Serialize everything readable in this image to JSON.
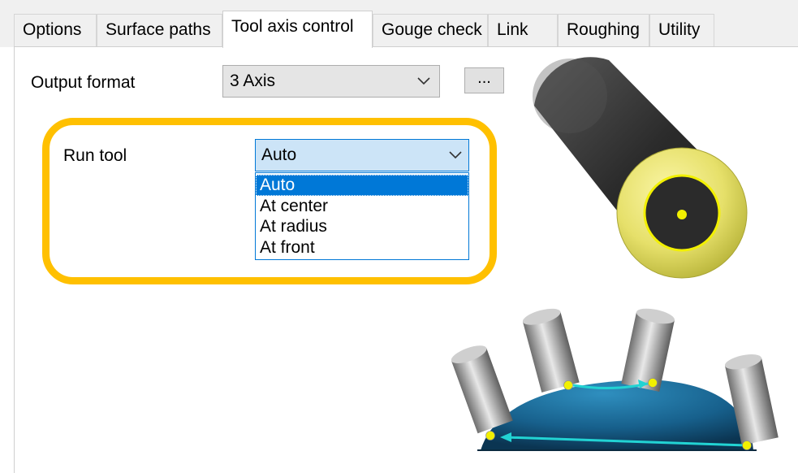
{
  "tabs": [
    {
      "label": "Options",
      "active": false
    },
    {
      "label": "Surface paths",
      "active": false
    },
    {
      "label": "Tool axis control",
      "active": true
    },
    {
      "label": "Gouge check",
      "active": false
    },
    {
      "label": "Link",
      "active": false
    },
    {
      "label": "Roughing",
      "active": false
    },
    {
      "label": "Utility",
      "active": false
    }
  ],
  "output_format": {
    "label": "Output format",
    "value": "3 Axis",
    "more_button": "..."
  },
  "run_tool": {
    "label": "Run tool",
    "value": "Auto",
    "options": [
      "Auto",
      "At center",
      "At radius",
      "At front"
    ],
    "selected_index": 0
  },
  "colors": {
    "highlight": "#ffc000",
    "selection": "#0078d7",
    "combo_focus_bg": "#cce4f7",
    "tool_yellow": "#e8e45a",
    "surface_blue": "#1f6e9c",
    "path_cyan": "#22d3d3"
  }
}
